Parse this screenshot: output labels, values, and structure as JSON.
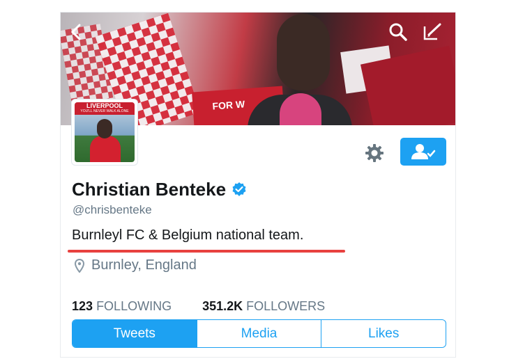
{
  "header": {
    "banner_text": "FOR W",
    "icons": [
      "back-icon",
      "search-icon",
      "compose-icon"
    ]
  },
  "avatar": {
    "band_title": "LIVERPOOL",
    "band_sub": "YOU'LL NEVER WALK ALONE"
  },
  "profile": {
    "name": "Christian Benteke",
    "handle": "@chrisbenteke",
    "bio": "Burnleyl FC & Belgium national team.",
    "location": "Burnley, England"
  },
  "stats": {
    "following_count": "123",
    "following_label": "FOLLOWING",
    "followers_count": "351.2K",
    "followers_label": "FOLLOWERS"
  },
  "tabs": [
    {
      "label": "Tweets",
      "active": true
    },
    {
      "label": "Media",
      "active": false
    },
    {
      "label": "Likes",
      "active": false
    }
  ],
  "colors": {
    "accent": "#1da1f2",
    "underline": "#e8413f",
    "text": "#14171a",
    "muted": "#657786"
  }
}
